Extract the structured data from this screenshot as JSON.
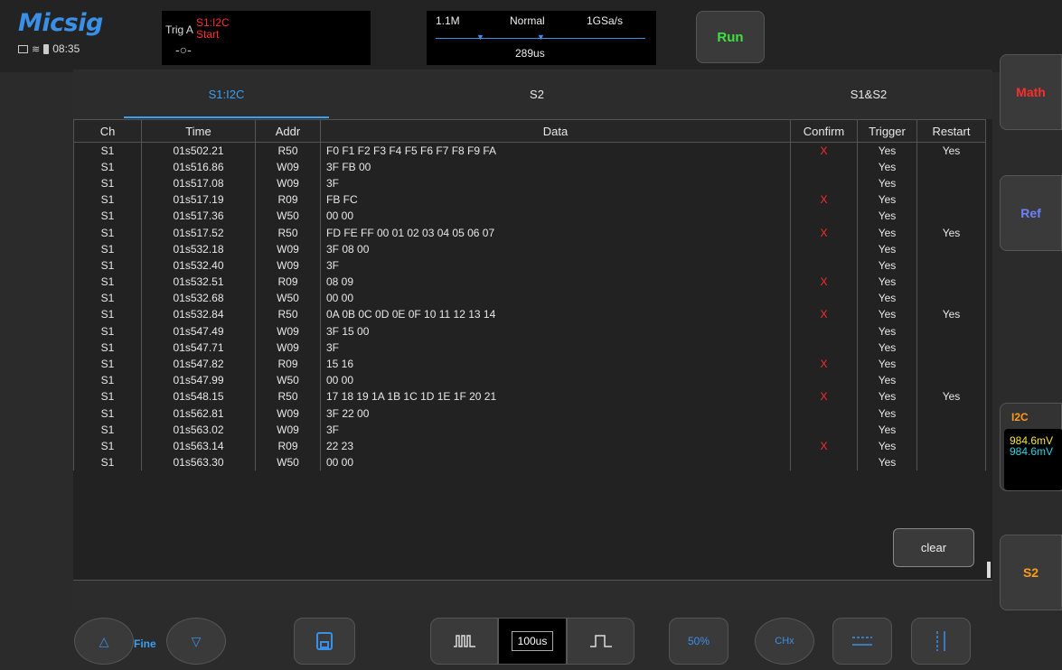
{
  "header": {
    "logo": "Micsig",
    "clock": "08:35",
    "trigger": {
      "label": "Trig  A",
      "source": "S1:I2C",
      "condition": "Start",
      "symbol": "-○-"
    },
    "timebase": {
      "memory": "1.1M",
      "mode": "Normal",
      "sample_rate": "1GSa/s",
      "position": "289us"
    },
    "run_label": "Run"
  },
  "side": {
    "math_label": "Math",
    "ref_label": "Ref",
    "i2c_title": "I2C",
    "i2c_value1": "984.6mV",
    "i2c_value2": "984.6mV",
    "s2_label": "S2",
    "colors": {
      "math": "#ff2c2c",
      "ref": "#6b84ff",
      "i2c": "#ff9a1a",
      "s2": "#ff9a1a"
    }
  },
  "tabs": [
    "S1:I2C",
    "S2",
    "S1&S2"
  ],
  "table": {
    "headers": [
      "Ch",
      "Time",
      "Addr",
      "Data",
      "Confirm",
      "Trigger",
      "Restart"
    ],
    "rows": [
      [
        "S1",
        "01s502.21",
        "R50",
        "F0 F1 F2 F3 F4 F5 F6 F7 F8 F9 FA",
        "X",
        "Yes",
        "Yes"
      ],
      [
        "S1",
        "01s516.86",
        "W09",
        "3F FB 00",
        "",
        "Yes",
        ""
      ],
      [
        "S1",
        "01s517.08",
        "W09",
        "3F",
        "",
        "Yes",
        ""
      ],
      [
        "S1",
        "01s517.19",
        "R09",
        "FB FC",
        "X",
        "Yes",
        ""
      ],
      [
        "S1",
        "01s517.36",
        "W50",
        "00 00",
        "",
        "Yes",
        ""
      ],
      [
        "S1",
        "01s517.52",
        "R50",
        "FD FE FF 00 01 02 03 04 05 06 07",
        "X",
        "Yes",
        "Yes"
      ],
      [
        "S1",
        "01s532.18",
        "W09",
        "3F 08 00",
        "",
        "Yes",
        ""
      ],
      [
        "S1",
        "01s532.40",
        "W09",
        "3F",
        "",
        "Yes",
        ""
      ],
      [
        "S1",
        "01s532.51",
        "R09",
        "08 09",
        "X",
        "Yes",
        ""
      ],
      [
        "S1",
        "01s532.68",
        "W50",
        "00 00",
        "",
        "Yes",
        ""
      ],
      [
        "S1",
        "01s532.84",
        "R50",
        "0A 0B 0C 0D 0E 0F 10 11 12 13 14",
        "X",
        "Yes",
        "Yes"
      ],
      [
        "S1",
        "01s547.49",
        "W09",
        "3F 15 00",
        "",
        "Yes",
        ""
      ],
      [
        "S1",
        "01s547.71",
        "W09",
        "3F",
        "",
        "Yes",
        ""
      ],
      [
        "S1",
        "01s547.82",
        "R09",
        "15 16",
        "X",
        "Yes",
        ""
      ],
      [
        "S1",
        "01s547.99",
        "W50",
        "00 00",
        "",
        "Yes",
        ""
      ],
      [
        "S1",
        "01s548.15",
        "R50",
        "17 18 19 1A 1B 1C 1D 1E 1F 20 21",
        "X",
        "Yes",
        "Yes"
      ],
      [
        "S1",
        "01s562.81",
        "W09",
        "3F 22 00",
        "",
        "Yes",
        ""
      ],
      [
        "S1",
        "01s563.02",
        "W09",
        "3F",
        "",
        "Yes",
        ""
      ],
      [
        "S1",
        "01s563.14",
        "R09",
        "22 23",
        "X",
        "Yes",
        ""
      ],
      [
        "S1",
        "01s563.30",
        "W50",
        "00 00",
        "",
        "Yes",
        ""
      ]
    ]
  },
  "clear_label": "clear",
  "toolbar": {
    "fine_label": "Fine",
    "timebase_value": "100us",
    "fifty_label": "50%",
    "chx_label": "CHx"
  }
}
